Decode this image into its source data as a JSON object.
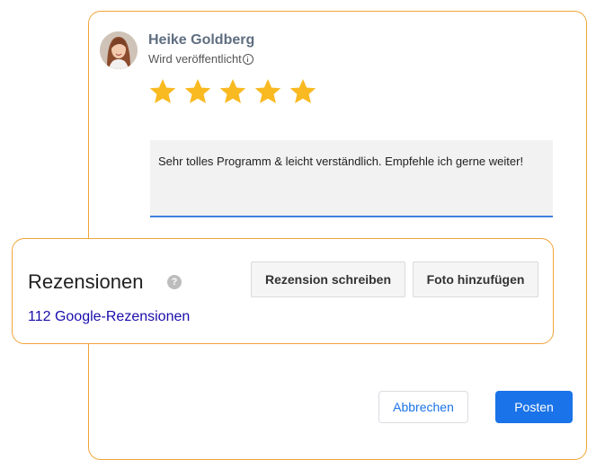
{
  "reviewer": {
    "name": "Heike Goldberg",
    "status": "Wird veröffentlicht",
    "info_icon": "info-icon",
    "rating": 5,
    "rating_max": 5,
    "star_color": "#f9b921"
  },
  "comment": {
    "text": "Sehr tolles Programm & leicht verständlich. Empfehle ich gerne weiter!"
  },
  "reviews": {
    "title": "Rezensionen",
    "help_icon_glyph": "?",
    "count_link": "112 Google-Rezensionen",
    "write_button": "Rezension schreiben",
    "photo_button": "Foto hinzufügen"
  },
  "actions": {
    "cancel": "Abbrechen",
    "post": "Posten"
  },
  "colors": {
    "accent": "#1a73e8",
    "highlight_border": "#f0a53a",
    "link": "#1a0dab"
  }
}
